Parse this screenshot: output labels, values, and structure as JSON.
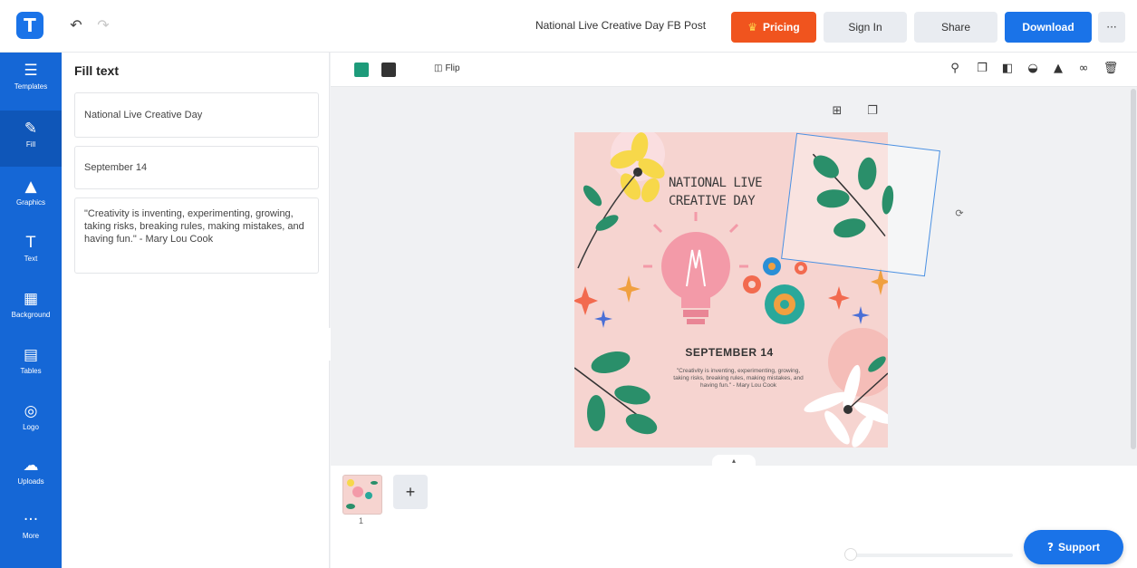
{
  "header": {
    "logo_letter": "T",
    "undo_icon": "↶",
    "redo_icon": "↷",
    "doc_title": "National Live Creative Day FB Post",
    "pricing_label": "Pricing",
    "signin_label": "Sign In",
    "share_label": "Share",
    "download_label": "Download",
    "more_label": "···"
  },
  "sidebar": {
    "items": [
      {
        "label": "Templates",
        "icon": "☰"
      },
      {
        "label": "Fill",
        "icon": "✎"
      },
      {
        "label": "Graphics",
        "icon": "▲"
      },
      {
        "label": "Text",
        "icon": "T"
      },
      {
        "label": "Background",
        "icon": "▦"
      },
      {
        "label": "Tables",
        "icon": "▤"
      },
      {
        "label": "Logo",
        "icon": "◎"
      },
      {
        "label": "Uploads",
        "icon": "☁"
      },
      {
        "label": "More",
        "icon": "···"
      }
    ]
  },
  "panel": {
    "title": "Fill text",
    "fields": [
      "National Live Creative Day",
      "September 14",
      "\"Creativity is inventing, experimenting, growing, taking risks, breaking rules, making mistakes, and having fun.\" - Mary Lou Cook"
    ]
  },
  "toolbar": {
    "flip_label": "Flip",
    "colors": [
      "#1e9b7a",
      "#333333"
    ]
  },
  "artboard": {
    "headline_line1": "NATIONAL LIVE",
    "headline_line2": "CREATIVE DAY",
    "date": "SEPTEMBER 14",
    "quote": "\"Creativity is inventing, experimenting, growing, taking risks, breaking rules, making mistakes, and having fun.\" - Mary Lou Cook"
  },
  "pages": {
    "page_number": "1",
    "add_label": "+"
  },
  "support": {
    "label": "Support"
  },
  "colors": {
    "primary": "#1a73e8",
    "pricing": "#f0541e",
    "artboard_bg": "#f6d4d0"
  }
}
